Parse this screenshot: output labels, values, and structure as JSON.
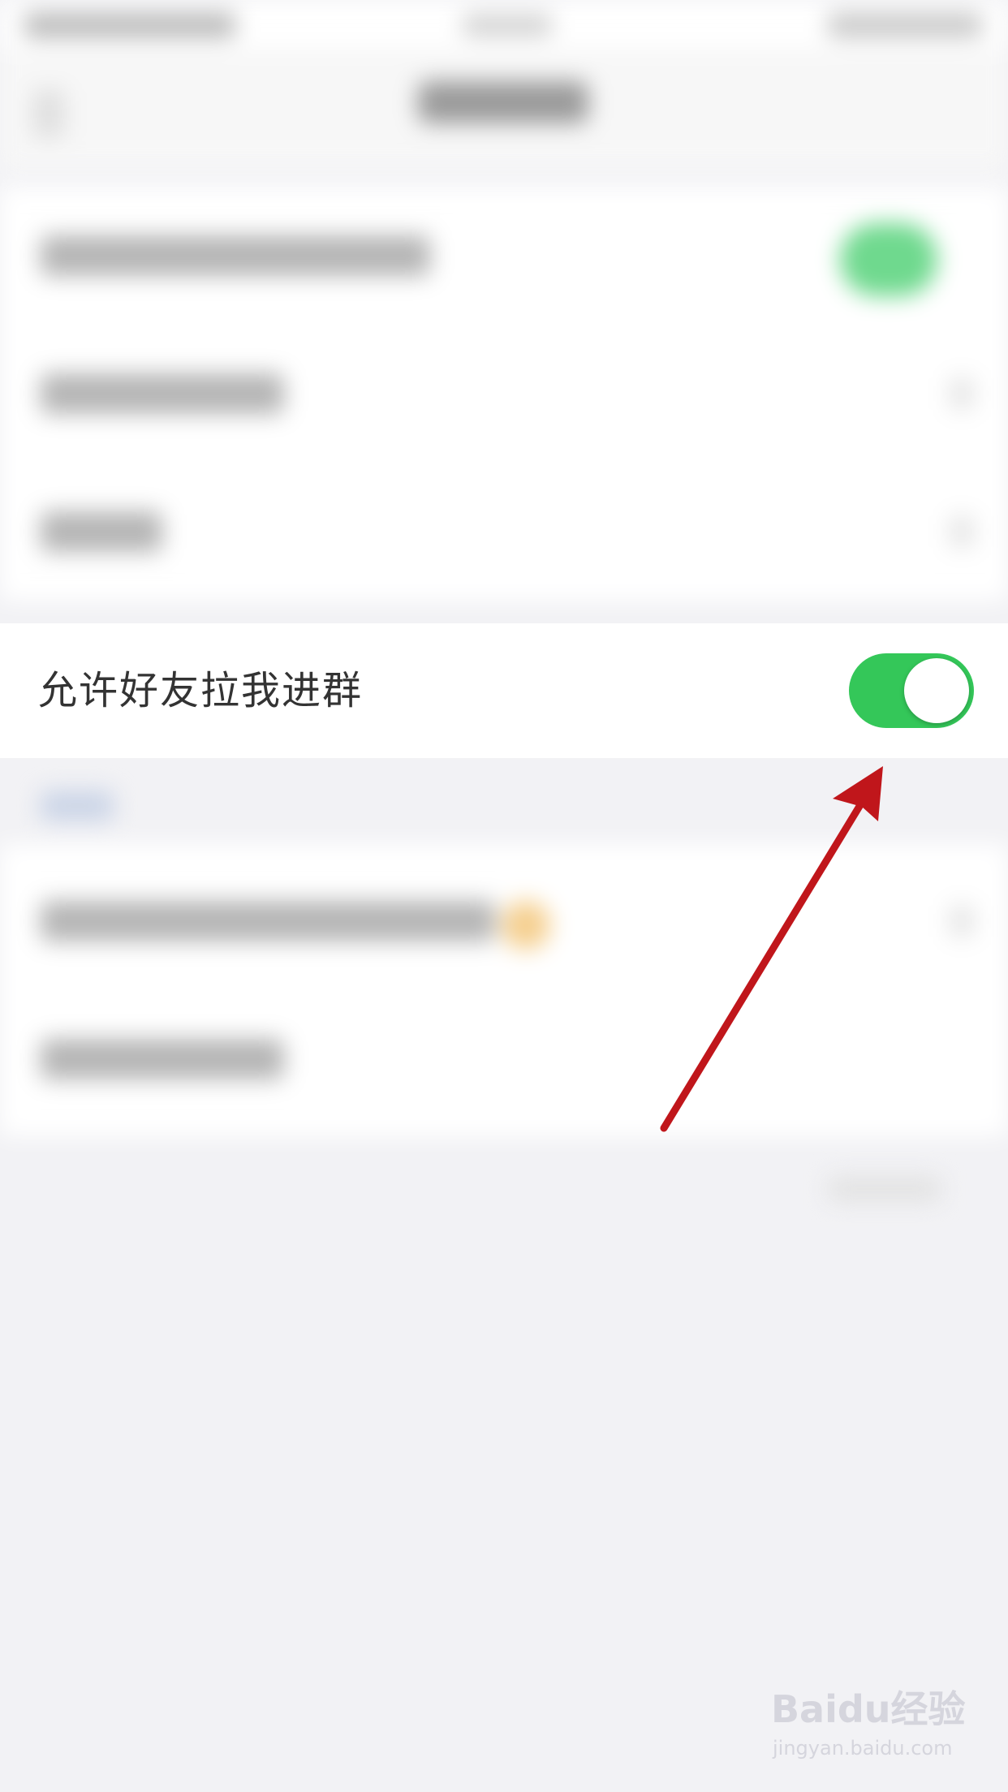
{
  "setting_row": {
    "label": "允许好友拉我进群",
    "toggle_on": true
  },
  "colors": {
    "toggle_on": "#34c759",
    "arrow": "#c0161b",
    "background": "#f2f2f5"
  },
  "annotation": {
    "type": "red-arrow",
    "target": "toggle"
  },
  "watermark": {
    "logo": "Baidu经验",
    "url": "jingyan.baidu.com"
  }
}
